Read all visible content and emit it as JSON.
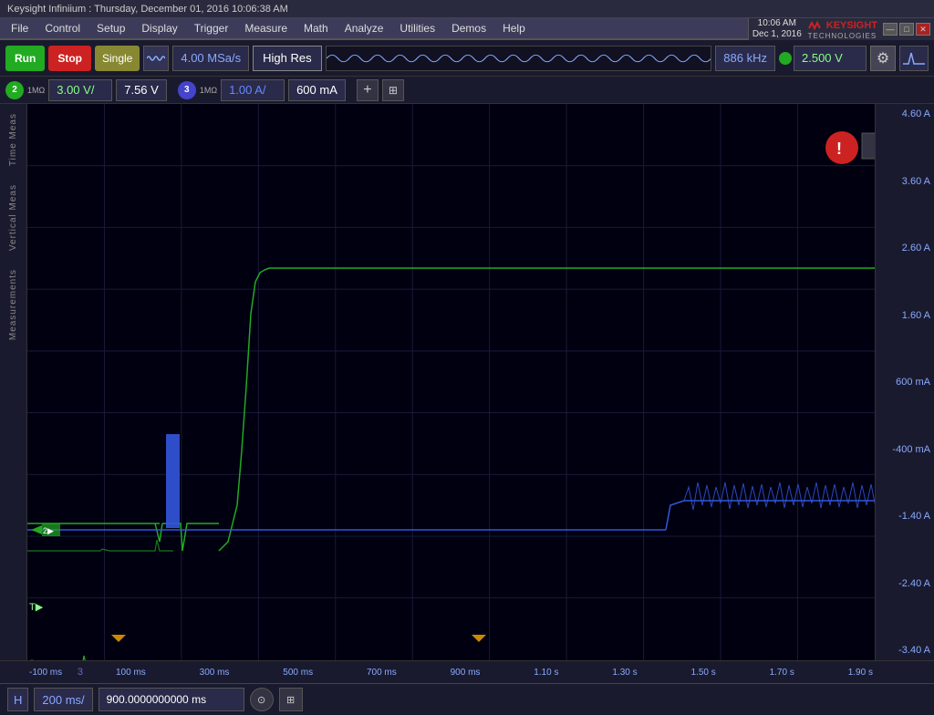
{
  "titlebar": {
    "text": "Keysight Infiniium : Thursday, December 01, 2016 10:06:38 AM"
  },
  "menubar": {
    "items": [
      "File",
      "Control",
      "Setup",
      "Display",
      "Trigger",
      "Measure",
      "Math",
      "Analyze",
      "Utilities",
      "Demos",
      "Help"
    ]
  },
  "topright": {
    "clock_line1": "10:06 AM",
    "clock_line2": "Dec 1, 2016",
    "logo_main": "KEYSIGHT",
    "logo_sub": "TECHNOLOGIES",
    "win_min": "—",
    "win_max": "□",
    "win_close": "✕"
  },
  "toolbar": {
    "run_label": "Run",
    "stop_label": "Stop",
    "single_label": "Single",
    "sample_rate": "4.00 MSa/s",
    "highres_label": "High Res",
    "frequency": "886 kHz",
    "trigger_level": "2.500 V",
    "colors": {
      "run": "#22aa22",
      "stop": "#cc2222",
      "trigger_dot": "#22aa22"
    }
  },
  "channels": {
    "ch2": {
      "number": "2",
      "impedance": "1MΩ",
      "volts_per_div": "3.00 V/",
      "value": "7.56 V",
      "color": "#22aa22"
    },
    "ch3": {
      "number": "3",
      "impedance": "1MΩ",
      "amps_per_div": "1.00 A/",
      "value": "600 mA",
      "color": "#4444cc"
    },
    "add_label": "+",
    "grid_label": "⊞"
  },
  "scope": {
    "y_axis_labels": [
      "4.60 A",
      "3.60 A",
      "2.60 A",
      "1.60 A",
      "600 mA",
      "-400 mA",
      "-1.40 A",
      "-2.40 A",
      "-3.40 A"
    ],
    "x_axis_labels": [
      "-100 ms",
      "100 ms",
      "300 ms",
      "500 ms",
      "700 ms",
      "900 ms",
      "1.10 s",
      "1.30 s",
      "1.50 s",
      "1.70 s",
      "1.90 s"
    ],
    "colors": {
      "background": "#000010",
      "grid": "#1a1a3a",
      "ch2_trace": "#22aa22",
      "ch3_trace": "#3355cc",
      "alert_bg": "#cc2222"
    }
  },
  "bottom_bar": {
    "h_label": "H",
    "time_per_div": "200 ms/",
    "time_offset": "900.0000000000 ms",
    "knob_symbol": "⊙",
    "extra_btn": "⊞"
  },
  "sidebar_labels": {
    "time_meas": "Time Meas",
    "vertical_meas": "Vertical Meas",
    "measurements": "Measurements"
  }
}
